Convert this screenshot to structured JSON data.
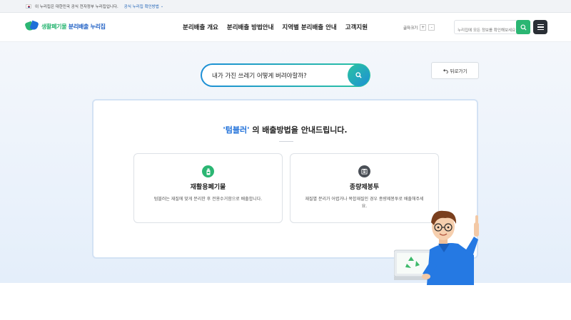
{
  "gov_bar": {
    "notice": "이 누리집은 대한민국 공식 전자정부 누리집입니다.",
    "verify_link": "공식 누리집 확인방법"
  },
  "header": {
    "logo_text_green": "생활폐기물",
    "logo_text_blue": " 분리배출 누리집",
    "nav": [
      "분리배출 개요",
      "분리배출 방법안내",
      "지역별 분리배출 안내",
      "고객지원"
    ],
    "font_size_label": "글자크기",
    "font_plus": "+",
    "font_minus": "-",
    "search_placeholder": "누리집에 모든 정보를 확인해보세요"
  },
  "hero": {
    "back_label": "뒤로가기",
    "search_query": "내가 가진 쓰레기 어떻게 버려야할까?",
    "result_keyword": "'텀블러'",
    "result_suffix": " 의 배출방법을 안내드립니다.",
    "methods": [
      {
        "title": "재활용폐기물",
        "desc": "텀블러는 재질에 맞게 분리한 후 전용수거함으로 배출합니다.",
        "icon": "bottle-icon"
      },
      {
        "title": "종량제봉투",
        "desc": "재질별 분리가 어렵거나 복합재질인 경우 종량제봉투로 배출해주세요.",
        "icon": "trash-bag-icon"
      }
    ]
  },
  "colors": {
    "accent_green": "#2bb673",
    "accent_blue": "#1e6fd9",
    "hero_bg": "#e9f1fb"
  }
}
